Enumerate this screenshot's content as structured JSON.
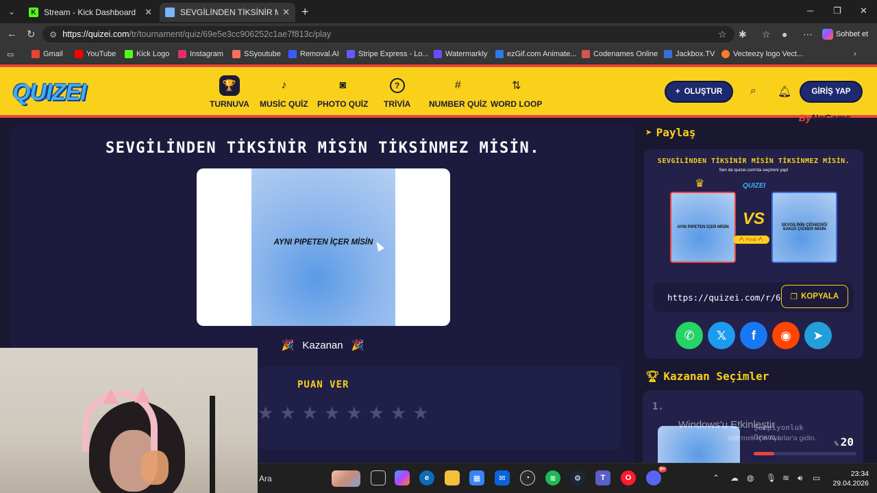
{
  "browser": {
    "tabs": [
      {
        "title": "Stream - Kick Dashboard",
        "favicon_color": "#53fc18"
      },
      {
        "title": "SEVGİLİNDEN TİKSİNİR MİSİN TİKS",
        "favicon_color": "#7bb4ff"
      }
    ],
    "url_host": "https://quizei.com",
    "url_path": "/tr/tournament/quiz/69e5e3cc906252c1ae7f813c/play",
    "copilot_label": "Sohbet et",
    "bookmarks": [
      {
        "label": "Gmail",
        "color": "#ea4335"
      },
      {
        "label": "YouTube",
        "color": "#ff0000"
      },
      {
        "label": "Kick Logo",
        "color": "#53fc18"
      },
      {
        "label": "Instagram",
        "color": "#e1306c"
      },
      {
        "label": "SSyoutube",
        "color": "#ff6f61"
      },
      {
        "label": "Removal.AI",
        "color": "#3b5bff"
      },
      {
        "label": "Stripe Express - Lo...",
        "color": "#635bff"
      },
      {
        "label": "Watermarkly",
        "color": "#6a4cff"
      },
      {
        "label": "ezGif.com Animate...",
        "color": "#2d7be5"
      },
      {
        "label": "Codenames Online",
        "color": "#d9534f"
      },
      {
        "label": "Jackbox.TV",
        "color": "#3a6fd8"
      },
      {
        "label": "Vecteezy logo Vect...",
        "color": "#ff7a2d"
      }
    ]
  },
  "site": {
    "logo": "QUIZEI",
    "nav": [
      {
        "label": "TURNUVA",
        "icon": "🏆"
      },
      {
        "label": "MUSİC QUİZ",
        "icon": "♪"
      },
      {
        "label": "PHOTO QUİZ",
        "icon": "◙"
      },
      {
        "label": "TRİVİA",
        "icon": "?"
      },
      {
        "label": "NUMBER QUİZ",
        "icon": "#"
      },
      {
        "label": "WORD LOOP",
        "icon": "⇅"
      }
    ],
    "create_label": "OLUŞTUR",
    "login_label": "GİRİŞ YAP",
    "sponsor_a": "By",
    "sponsor_b": "NoGame"
  },
  "quiz": {
    "title": "SEVGİLİNDEN TİKSİNİR MİSİN TİKSİNMEZ MİSİN.",
    "winner_caption": "AYNI PIPETEN İÇER MİSİN",
    "winner_label": "Kazanan",
    "rate_label": "PUAN VER"
  },
  "share": {
    "heading": "Paylaş",
    "preview_title": "SEVGİLİNDEN TİKSİNİR MİSİN TİKSİNMEZ MİSİN.",
    "preview_sub": "Sen de quizei.com'da seçimini yap!",
    "preview_logo": "QUIZEI",
    "card_left": "AYNI PIPETEN İÇER MİSİN",
    "card_right": "SEVGİLİNİN ÇİĞNEDİĞİ SAKIZI ÇİĞNER MİSİN",
    "vs": "VS",
    "final_badge": "🔥 Final 🔥",
    "link": "https://quizei.com/r/6",
    "copy_label": "KOPYALA"
  },
  "winners": {
    "heading": "Kazanan Seçimler",
    "rank": "1.",
    "champ_label_1": "Şampiyonluk",
    "champ_label_2": "Oranı:",
    "pct_sign": "%",
    "pct": "20",
    "pct_value": 0.2
  },
  "os": {
    "watermark_1": "Windows'u Etkinleştir",
    "watermark_2": "eştirmek için Ayarlar'a gidin.",
    "search_label": "Ara",
    "time": "23:34",
    "date": "29.04.2026",
    "discord_badge": "9+"
  }
}
